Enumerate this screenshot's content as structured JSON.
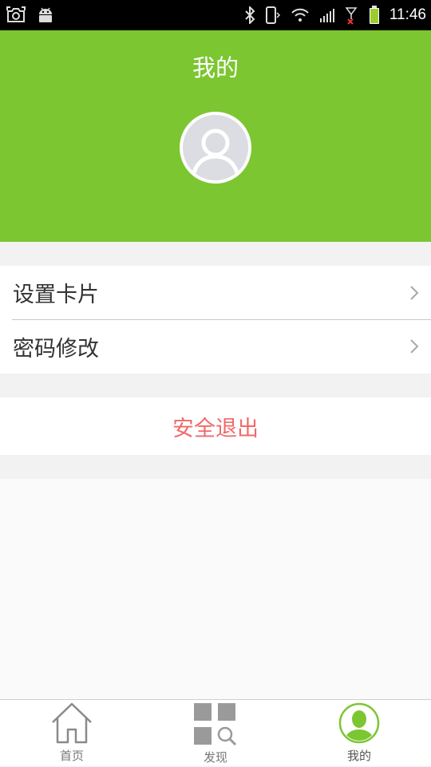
{
  "status_bar": {
    "time": "11:46",
    "icons": [
      "screenshot-icon",
      "android-icon",
      "bluetooth-icon",
      "vibrate-icon",
      "wifi-icon",
      "signal-icon",
      "no-sim-signal-icon",
      "battery-icon"
    ]
  },
  "header": {
    "title": "我的",
    "background_color": "#7cc631"
  },
  "menu": {
    "items": [
      {
        "label": "设置卡片",
        "icon": "chevron-right-icon"
      },
      {
        "label": "密码修改",
        "icon": "chevron-right-icon"
      }
    ]
  },
  "logout": {
    "label": "安全退出",
    "color": "#f0696a"
  },
  "bottom_nav": {
    "active": "我的",
    "items": [
      {
        "label": "首页",
        "icon": "home-icon"
      },
      {
        "label": "发现",
        "icon": "discover-grid-icon"
      },
      {
        "label": "我的",
        "icon": "profile-avatar-icon"
      }
    ]
  }
}
